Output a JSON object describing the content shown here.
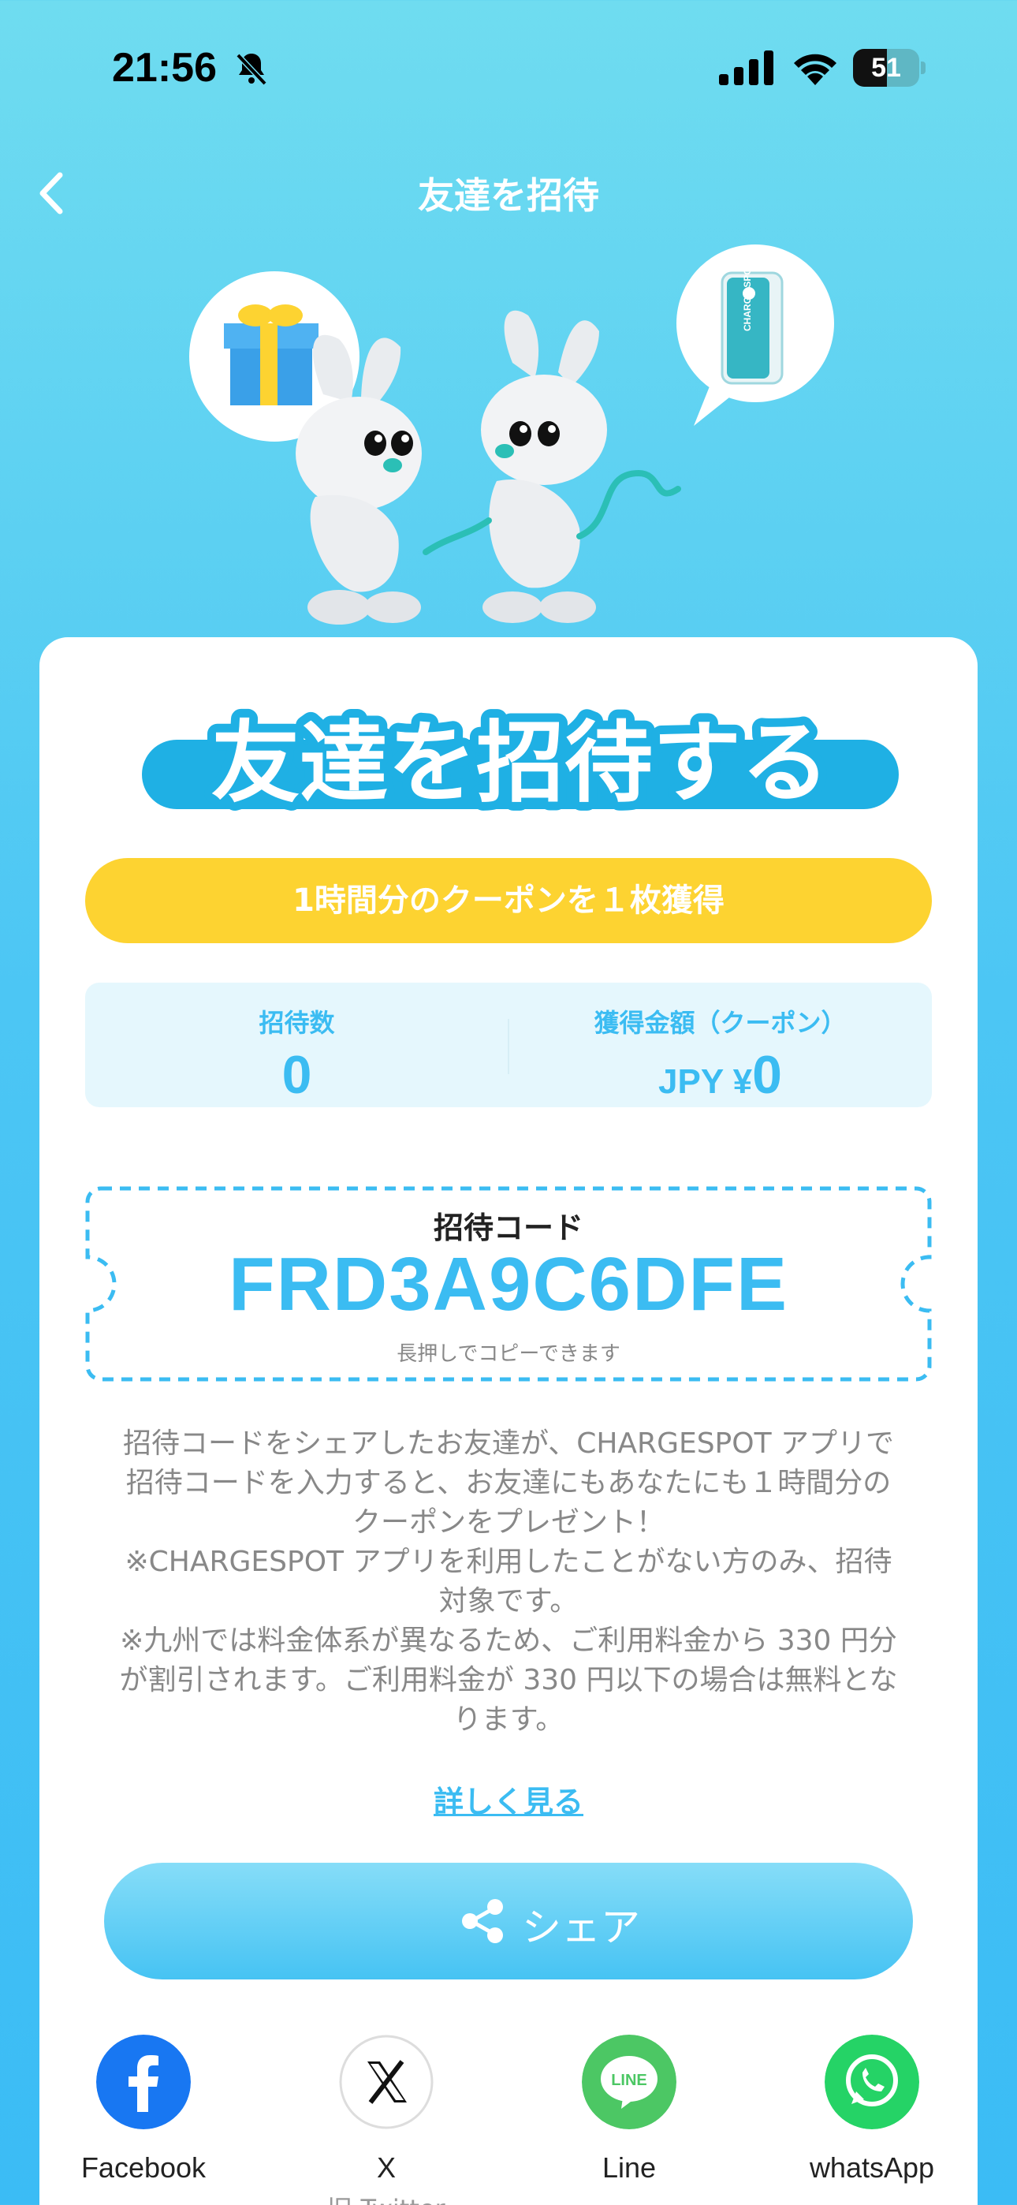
{
  "status_bar": {
    "time": "21:56",
    "battery_level": "51",
    "battery_fraction": 0.51
  },
  "nav": {
    "title": "友達を招待",
    "back_icon": "chevron-left-icon"
  },
  "hero": {
    "illustration": "two-mascot-rabbits-with-gift-and-battery-bubbles",
    "powerbank_text": "CHARGE SPOT"
  },
  "card": {
    "headline": "友達を招待する",
    "reward_pill": "1時間分のクーポンを１枚獲得",
    "stats": {
      "invites_label": "招待数",
      "invites_value": "0",
      "earned_label": "獲得金額（クーポン）",
      "earned_prefix": "JPY ¥",
      "earned_value": "0"
    },
    "invite_code": {
      "label": "招待コード",
      "code": "FRD3A9C6DFE",
      "hint": "長押しでコピーできます"
    },
    "description": [
      "招待コードをシェアしたお友達が、CHARGESPOT アプリで",
      "招待コードを入力すると、お友達にもあなたにも１時間分の",
      "クーポンをプレゼント！",
      "※CHARGESPOT アプリを利用したことがない方のみ、招待",
      "対象です。",
      "※九州では料金体系が異なるため、ご利用料金から 330 円分",
      "が割引されます。ご利用料金が 330 円以下の場合は無料とな",
      "ります。"
    ],
    "details_link": "詳しく見る",
    "share_button": "シェア",
    "social": [
      {
        "name": "Facebook",
        "icon": "facebook-icon",
        "color": "#1877f2"
      },
      {
        "name": "X",
        "sub": "旧 Twitter",
        "icon": "x-icon",
        "color": "#ffffff"
      },
      {
        "name": "Line",
        "icon": "line-icon",
        "color": "#4cc764"
      },
      {
        "name": "whatsApp",
        "icon": "whatsapp-icon",
        "color": "#25d366"
      }
    ]
  },
  "colors": {
    "accent": "#3bbcf2",
    "pill": "#fdd331",
    "bg_top": "#6fdcf0",
    "bg_bottom": "#3bbcf5"
  }
}
